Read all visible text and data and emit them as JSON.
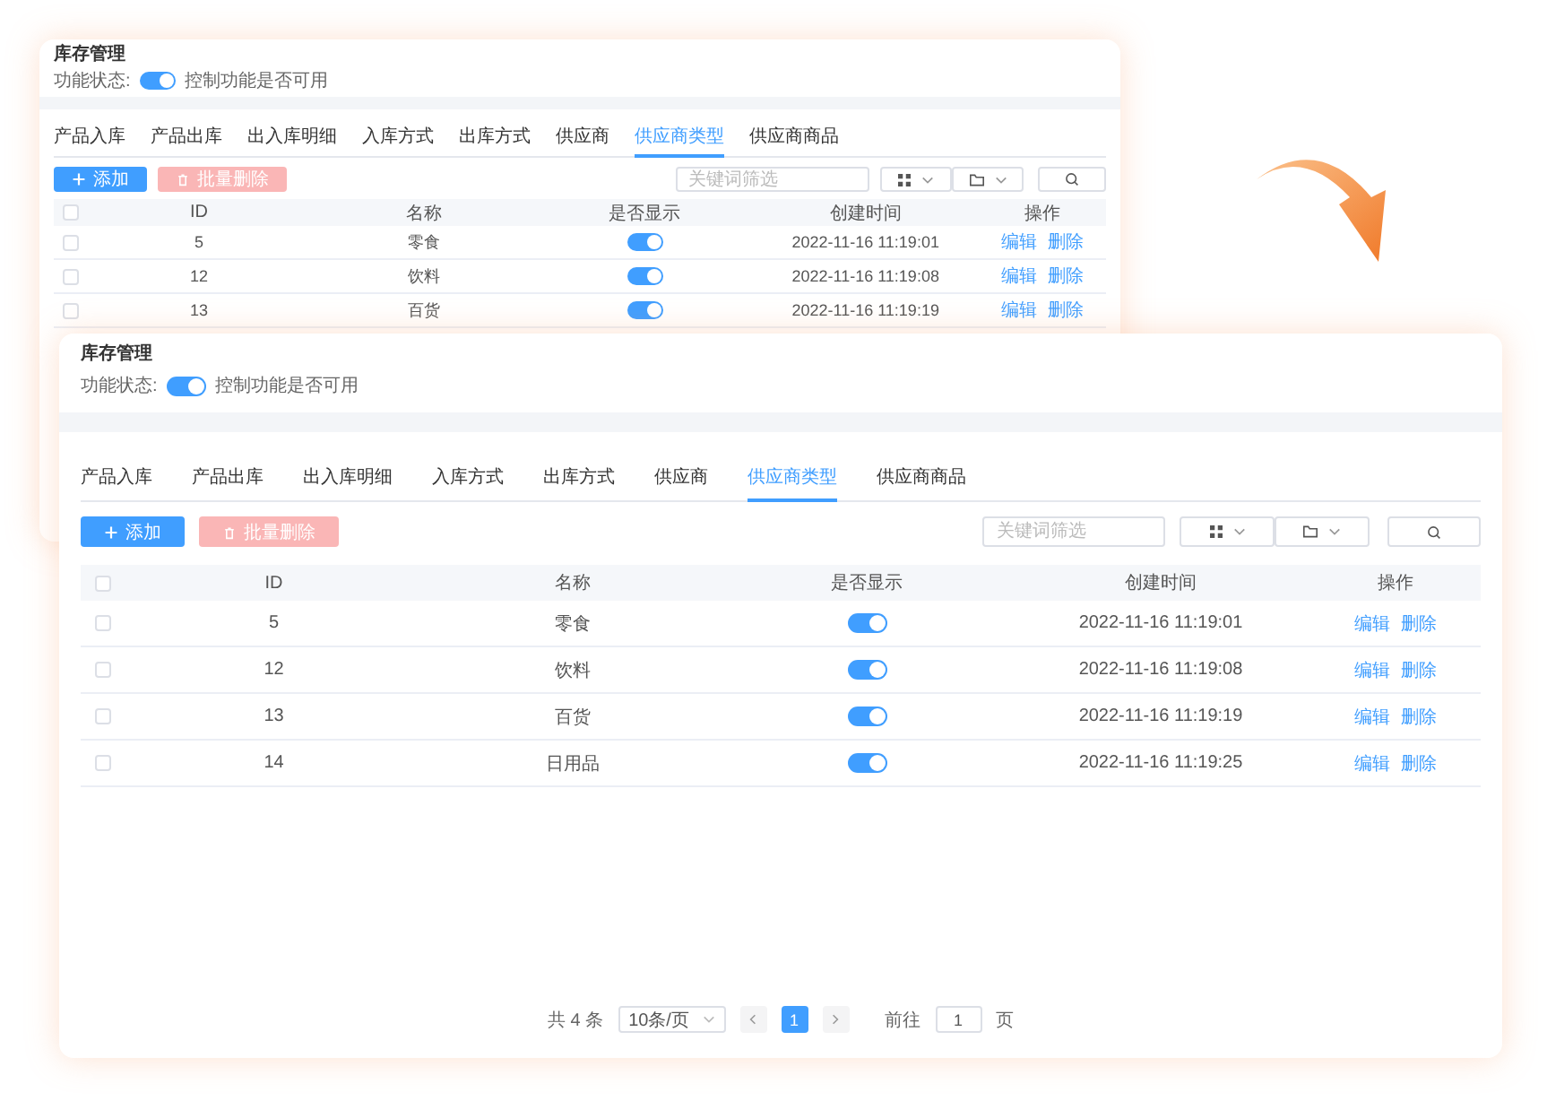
{
  "windows": [
    {
      "title": "库存管理",
      "status_label": "功能状态:",
      "status_toggle": {
        "on": true
      },
      "status_hint": "控制功能是否可用",
      "tabs": [
        {
          "label": "产品入库",
          "selected": false
        },
        {
          "label": "产品出库",
          "selected": false
        },
        {
          "label": "出入库明细",
          "selected": false
        },
        {
          "label": "入库方式",
          "selected": false
        },
        {
          "label": "出库方式",
          "selected": false
        },
        {
          "label": "供应商",
          "selected": false
        },
        {
          "label": "供应商类型",
          "selected": true
        },
        {
          "label": "供应商商品",
          "selected": false
        }
      ],
      "add_button": "添加",
      "batch_delete_button": {
        "label": "批量删除",
        "disabled": true
      },
      "search": {
        "placeholder": "关键词筛选"
      },
      "all_checked": false,
      "columns": [
        "ID",
        "名称",
        "是否显示",
        "创建时间",
        "操作"
      ],
      "rows": [
        {
          "checked": false,
          "id": "5",
          "name": "零食",
          "visible": true,
          "created": "2022-11-16 11:19:01",
          "actions": [
            "编辑",
            "删除"
          ]
        },
        {
          "checked": false,
          "id": "12",
          "name": "饮料",
          "visible": true,
          "created": "2022-11-16 11:19:08",
          "actions": [
            "编辑",
            "删除"
          ]
        },
        {
          "checked": false,
          "id": "13",
          "name": "百货",
          "visible": true,
          "created": "2022-11-16 11:19:19",
          "actions": [
            "编辑",
            "删除"
          ]
        }
      ]
    },
    {
      "title": "库存管理",
      "status_label": "功能状态:",
      "status_toggle": {
        "on": true
      },
      "status_hint": "控制功能是否可用",
      "tabs": [
        {
          "label": "产品入库",
          "selected": false
        },
        {
          "label": "产品出库",
          "selected": false
        },
        {
          "label": "出入库明细",
          "selected": false
        },
        {
          "label": "入库方式",
          "selected": false
        },
        {
          "label": "出库方式",
          "selected": false
        },
        {
          "label": "供应商",
          "selected": false
        },
        {
          "label": "供应商类型",
          "selected": true
        },
        {
          "label": "供应商商品",
          "selected": false
        }
      ],
      "add_button": "添加",
      "batch_delete_button": {
        "label": "批量删除",
        "disabled": true
      },
      "search": {
        "placeholder": "关键词筛选"
      },
      "all_checked": false,
      "columns": [
        "ID",
        "名称",
        "是否显示",
        "创建时间",
        "操作"
      ],
      "rows": [
        {
          "checked": false,
          "id": "5",
          "name": "零食",
          "visible": true,
          "created": "2022-11-16 11:19:01",
          "actions": [
            "编辑",
            "删除"
          ]
        },
        {
          "checked": false,
          "id": "12",
          "name": "饮料",
          "visible": true,
          "created": "2022-11-16 11:19:08",
          "actions": [
            "编辑",
            "删除"
          ]
        },
        {
          "checked": false,
          "id": "13",
          "name": "百货",
          "visible": true,
          "created": "2022-11-16 11:19:19",
          "actions": [
            "编辑",
            "删除"
          ]
        },
        {
          "checked": false,
          "id": "14",
          "name": "日用品",
          "visible": true,
          "created": "2022-11-16 11:19:25",
          "actions": [
            "编辑",
            "删除"
          ]
        }
      ],
      "pagination": {
        "total": "共 4 条",
        "page_size": "10条/页",
        "pages": [
          {
            "label": "1",
            "selected": true
          }
        ],
        "goto_label": "前往",
        "goto_value": "1",
        "goto_unit": "页"
      }
    }
  ]
}
